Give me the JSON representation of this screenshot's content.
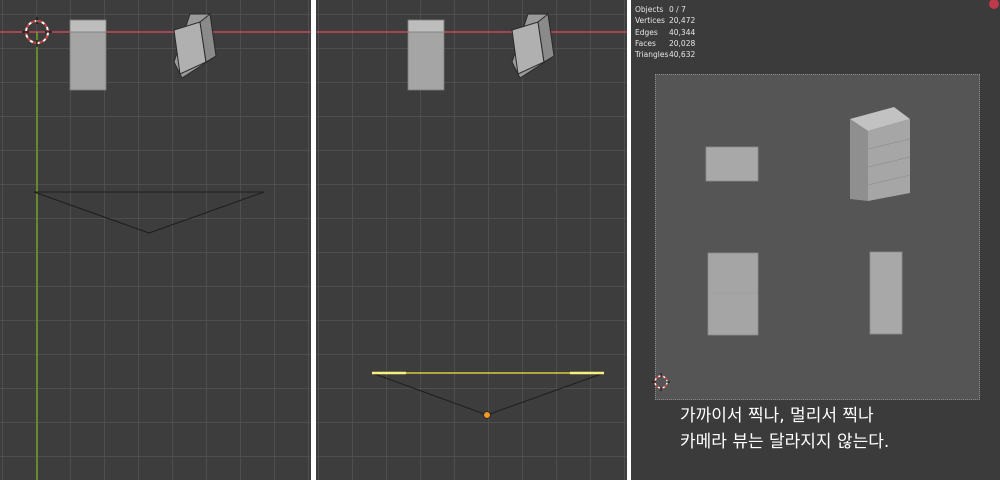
{
  "colors": {
    "viewport_bg": "#3d3d3d",
    "grid_line": "#4e4e4e",
    "x_axis": "#c34a5a",
    "y_axis": "#6e9a2a",
    "selection": "#f0e040",
    "camera_view_bg": "#555555",
    "object_gray": "#a3a3a3"
  },
  "icons": [
    "3d-cursor-icon",
    "camera-origin-dot-icon",
    "record-indicator-icon"
  ],
  "viewport_left": {
    "name": "top-view-perspective-camera"
  },
  "viewport_middle": {
    "name": "top-view-orthographic-camera-selected"
  },
  "camera_view": {
    "stats": [
      {
        "label": "Objects",
        "value": "0 / 7"
      },
      {
        "label": "Vertices",
        "value": "20,472"
      },
      {
        "label": "Edges",
        "value": "40,344"
      },
      {
        "label": "Faces",
        "value": "20,028"
      },
      {
        "label": "Triangles",
        "value": "40,632"
      }
    ],
    "caption_line1": "가까이서 찍나, 멀리서 찍나",
    "caption_line2": "카메라 뷰는 달라지지 않는다."
  }
}
